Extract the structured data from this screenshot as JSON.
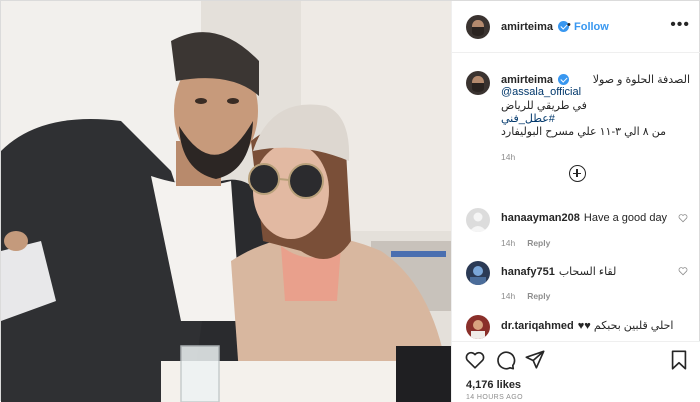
{
  "header": {
    "username": "amirteima",
    "separator": "•",
    "follow_label": "Follow",
    "more_label": "•••"
  },
  "caption": {
    "username": "amirteima",
    "lines": [
      "الصدفة الحلوة و صولا",
      "@assala_official",
      "في طريقي للرياض",
      "#عطل_فني",
      "من ٨ الي ٣-١١ علي مسرح البوليفارد"
    ],
    "time": "14h"
  },
  "comments": [
    {
      "username": "hanaayman208",
      "text": "Have a good day",
      "time": "14h",
      "reply_label": "Reply"
    },
    {
      "username": "hanafy751",
      "text": "لقاء السحاب",
      "time": "14h",
      "reply_label": "Reply"
    },
    {
      "username": "dr.tariqahmed",
      "text": "♥♥ احلي قلبين بحبكم",
      "time": "",
      "reply_label": ""
    }
  ],
  "footer": {
    "likes": "4,176 likes",
    "timestamp": "14 HOURS AGO"
  },
  "icons": {
    "verified": "verified-badge-icon",
    "like": "heart-icon",
    "comment": "comment-icon",
    "share": "paper-plane-icon",
    "save": "bookmark-icon",
    "add_comments": "plus-circle-icon"
  },
  "colors": {
    "accent": "#3897f0",
    "link": "#00376b",
    "muted": "#8e8e8e",
    "text": "#262626"
  }
}
